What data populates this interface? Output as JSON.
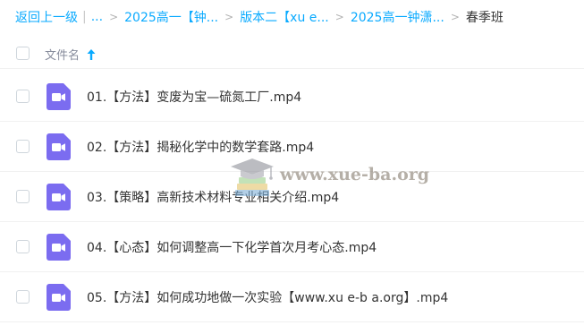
{
  "breadcrumb": {
    "back_label": "返回上一级",
    "ellipsis": "...",
    "separator": ">",
    "crumbs": [
      "2025高一【钟...",
      "版本二【xu e...",
      "2025高一钟潇..."
    ],
    "current": "春季班"
  },
  "list_header": {
    "name_label": "文件名",
    "sort_icon": "arrow-up-icon"
  },
  "files": [
    {
      "name": "01.【方法】变废为宝—硫氮工厂.mp4",
      "icon": "video-file-icon"
    },
    {
      "name": "02.【方法】揭秘化学中的数学套路.mp4",
      "icon": "video-file-icon"
    },
    {
      "name": "03.【策略】高新技术材料专业相关介绍.mp4",
      "icon": "video-file-icon"
    },
    {
      "name": "04.【心态】如何调整高一下化学首次月考心态.mp4",
      "icon": "video-file-icon"
    },
    {
      "name": "05.【方法】如何成功地做一次实验【www.xu e-b a.org】.mp4",
      "icon": "video-file-icon"
    }
  ],
  "watermark": {
    "text": "www.xue-ba.org",
    "logo_icon": "graduation-cap-books-icon"
  },
  "colors": {
    "link": "#09aaff",
    "text": "#333333",
    "header_text": "#878c9c",
    "video_icon": "#7b6cf0",
    "divider": "#f1f1f1"
  }
}
